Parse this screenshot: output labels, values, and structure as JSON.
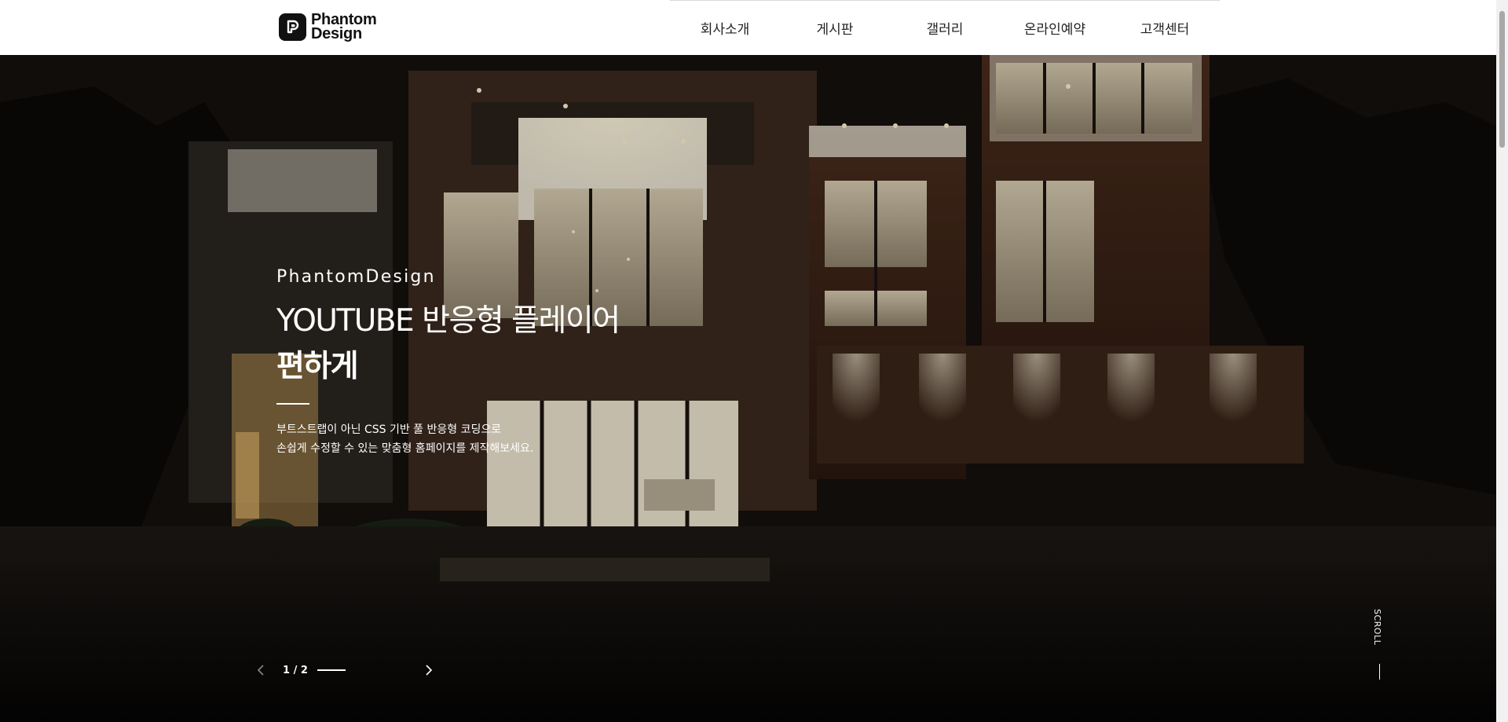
{
  "header": {
    "logo": {
      "line1": "Phantom",
      "line2": "Design",
      "icon": "phantom-logo-icon"
    },
    "nav": [
      {
        "label": "회사소개"
      },
      {
        "label": "게시판"
      },
      {
        "label": "갤러리"
      },
      {
        "label": "온라인예약"
      },
      {
        "label": "고객센터"
      }
    ]
  },
  "hero": {
    "eyebrow": "PhantomDesign",
    "headline_line1": "YOUTUBE 반응형 플레이어",
    "headline_line2": "편하게",
    "description_line1": "부트스트랩이 아닌 CSS 기반 풀 반응형 코딩으로",
    "description_line2": "손쉽게 수정할 수 있는 맞춤형 홈페이지를 제작해보세요.",
    "slide_counter": "1 / 2",
    "slide_progress_fraction": 0.5,
    "prev_icon": "chevron-left-icon",
    "next_icon": "chevron-right-icon",
    "scroll_label": "SCROLL"
  },
  "colors": {
    "header_bg": "#ffffff",
    "hero_text": "#ffffff",
    "accent_light": "#f3e2b8"
  }
}
